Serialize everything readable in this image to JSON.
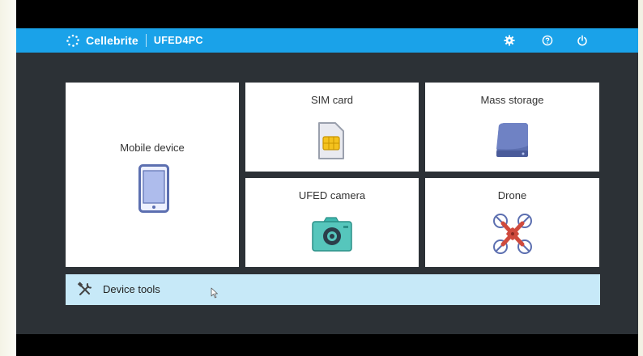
{
  "header": {
    "brand": "Cellebrite",
    "product": "UFED4PC",
    "icons": [
      "settings-gear-icon",
      "help-icon",
      "power-icon"
    ]
  },
  "tiles": {
    "mobile_device": {
      "label": "Mobile device",
      "icon": "phone-icon"
    },
    "sim_card": {
      "label": "SIM card",
      "icon": "sim-card-icon"
    },
    "mass_storage": {
      "label": "Mass storage",
      "icon": "hard-drive-icon"
    },
    "ufed_camera": {
      "label": "UFED camera",
      "icon": "camera-icon"
    },
    "drone": {
      "label": "Drone",
      "icon": "drone-icon"
    }
  },
  "device_tools": {
    "label": "Device tools",
    "icon": "tools-icon"
  },
  "colors": {
    "header": "#1aa2e9",
    "background": "#2c3136",
    "tile": "#ffffff",
    "tools_bar": "#c7e9f8",
    "icon_blue": "#5c6fb0",
    "icon_teal": "#3fb8ae",
    "icon_red": "#cf4a3d"
  }
}
